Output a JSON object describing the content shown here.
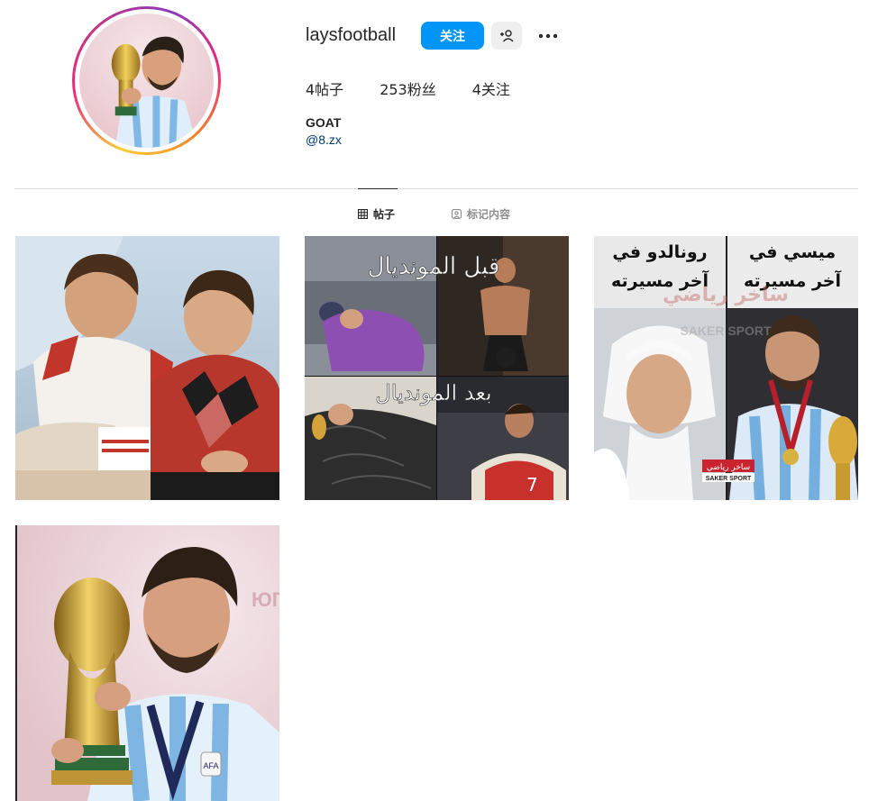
{
  "profile": {
    "username": "laysfootball",
    "follow_label": "关注",
    "stats": {
      "posts": "4帖子",
      "followers": "253粉丝",
      "following": "4关注"
    },
    "bio_name": "GOAT",
    "bio_link": "@8.zx"
  },
  "tabs": [
    {
      "label": "帖子",
      "icon": "grid-icon",
      "active": true
    },
    {
      "label": "标记内容",
      "icon": "tagged-icon",
      "active": false
    }
  ],
  "posts": [
    {
      "id": "post-1",
      "image": "childhood-photo-two-boys"
    },
    {
      "id": "post-2",
      "image": "before-after-world-cup-collage",
      "caption_top": "قبل المونديال",
      "caption_bottom": "بعد المونديال"
    },
    {
      "id": "post-3",
      "image": "ronaldo-messi-comparison",
      "caption_left": "رونالدو في آخر مسيرته",
      "caption_right": "ميسي في آخر مسيرته",
      "watermark": "ساخر رياضي",
      "watermark_en": "SAKER SPORT"
    },
    {
      "id": "post-4",
      "image": "trophy-kiss"
    }
  ],
  "colors": {
    "accent": "#0095f6",
    "text": "#262626",
    "muted": "#8e8e8e",
    "link": "#00376b",
    "divider": "#dbdbdb"
  }
}
